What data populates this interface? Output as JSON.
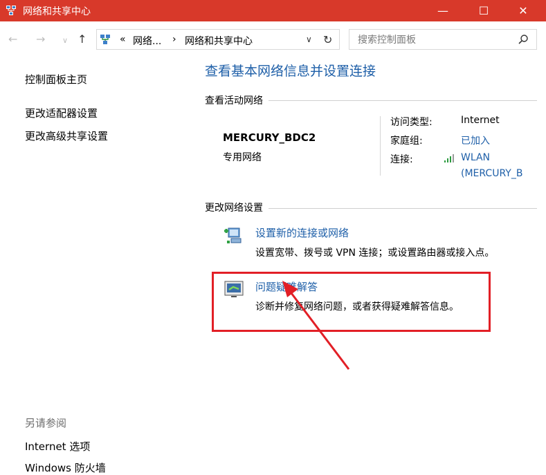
{
  "window": {
    "title": "网络和共享中心",
    "controls": {
      "minimize": "—",
      "maximize": "☐",
      "close": "✕"
    }
  },
  "nav": {
    "back": "←",
    "forward": "→",
    "recent": "∨",
    "up": "↑"
  },
  "address": {
    "overflow": "«",
    "crumb_1": "网络...",
    "separator": "›",
    "crumb_2": "网络和共享中心",
    "dropdown": "∨",
    "refresh": "↻"
  },
  "search": {
    "placeholder": "搜索控制面板"
  },
  "sidebar": {
    "home": "控制面板主页",
    "adapter": "更改适配器设置",
    "advanced_sharing": "更改高级共享设置",
    "see_also": "另请参阅",
    "internet_options": "Internet 选项",
    "firewall": "Windows 防火墙"
  },
  "main": {
    "title": "查看基本网络信息并设置连接",
    "active_networks_label": "查看活动网络",
    "network": {
      "name": "MERCURY_BDC2",
      "type": "专用网络",
      "access_type_label": "访问类型:",
      "access_type_value": "Internet",
      "homegroup_label": "家庭组:",
      "homegroup_value": "已加入",
      "connection_label": "连接:",
      "connection_value_1": "WLAN",
      "connection_value_2": "(MERCURY_B"
    },
    "change_settings_label": "更改网络设置",
    "tasks": [
      {
        "link": "设置新的连接或网络",
        "desc": "设置宽带、拨号或 VPN 连接；或设置路由器或接入点。",
        "icon": "new-connection-icon"
      },
      {
        "link": "问题疑难解答",
        "desc": "诊断并修复网络问题，或者获得疑难解答信息。",
        "icon": "troubleshoot-icon"
      }
    ]
  },
  "colors": {
    "titlebar": "#d8392a",
    "link": "#1e5fa8",
    "highlight": "#e21f26"
  }
}
